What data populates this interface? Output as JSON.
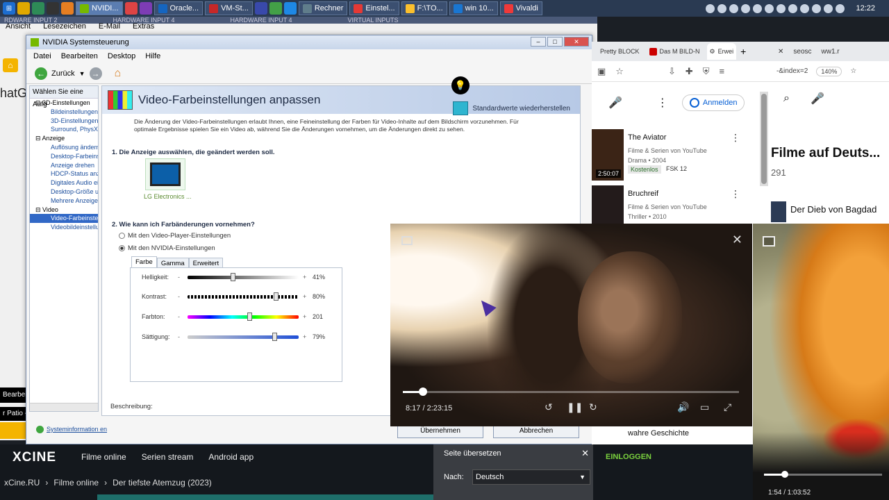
{
  "taskbar": {
    "start_icon": "windows-start-icon",
    "buttons": [
      {
        "label": "NVIDI...",
        "active": true
      },
      {
        "label": "Oracle..."
      },
      {
        "label": "VM-St..."
      },
      {
        "label": "Rechner"
      },
      {
        "label": "Einstel..."
      },
      {
        "label": "F:\\TO..."
      },
      {
        "label": "win 10..."
      },
      {
        "label": "Vivaldi"
      }
    ],
    "clock": "12:22"
  },
  "bg_browser": {
    "overlay_titles": [
      "RDWARE INPUT  2",
      "HARDWARE INPUT 4",
      "HARDWARE INPUT 4",
      "VIRTUAL INPUTS"
    ],
    "menu": [
      "Ansicht",
      "Lesezeichen",
      "E-Mail",
      "Extras"
    ],
    "chat_text": "hatG",
    "bearbeiten": "Bearbei",
    "patio": "r Patio -"
  },
  "nvidia": {
    "window_title": "NVIDIA Systemsteuerung",
    "menu": [
      "Datei",
      "Bearbeiten",
      "Desktop",
      "Hilfe"
    ],
    "back_label": "Zurück",
    "task_header": "Wählen Sie eine Aufg",
    "tree": [
      {
        "type": "g",
        "label": "3D-Einstellungen"
      },
      {
        "type": "i",
        "label": "Bildeinstellungen m"
      },
      {
        "type": "i",
        "label": "3D-Einstellungen"
      },
      {
        "type": "i",
        "label": "Surround, PhysX"
      },
      {
        "type": "g",
        "label": "Anzeige"
      },
      {
        "type": "i",
        "label": "Auflösung ändern"
      },
      {
        "type": "i",
        "label": "Desktop-Farbeins"
      },
      {
        "type": "i",
        "label": "Anzeige drehen"
      },
      {
        "type": "i",
        "label": "HDCP-Status anze"
      },
      {
        "type": "i",
        "label": "Digitales Audio ei"
      },
      {
        "type": "i",
        "label": "Desktop-Größe ur"
      },
      {
        "type": "i",
        "label": "Mehrere Anzeiger"
      },
      {
        "type": "g",
        "label": "Video"
      },
      {
        "type": "i",
        "label": "Video-Farbeinstel",
        "selected": true
      },
      {
        "type": "i",
        "label": "Videobildeinstellu"
      }
    ],
    "sysinfo_label": "Systeminformation en",
    "heading": "Video-Farbeinstellungen anpassen",
    "restore_label": "Standardwerte wiederherstellen",
    "description": "Die Änderung der Video-Farbeinstellungen erlaubt Ihnen, eine Feineinstellung der Farben für Video-Inhalte auf dem Bildschirm vorzunehmen. Für optimale Ergebnisse spielen Sie ein Video ab, während Sie die Änderungen vornehmen, um die Änderungen direkt zu sehen.",
    "step1": "1. Die Anzeige auswählen, die geändert werden soll.",
    "monitor_label": "LG Electronics ...",
    "step2": "2. Wie kann ich Farbänderungen vornehmen?",
    "radio1": "Mit den Video-Player-Einstellungen",
    "radio2": "Mit den NVIDIA-Einstellungen",
    "tabs": [
      "Farbe",
      "Gamma",
      "Erweitert"
    ],
    "sliders": [
      {
        "label": "Helligkeit:",
        "value_text": "41%",
        "level": 0.41
      },
      {
        "label": "Kontrast:",
        "value_text": "80%",
        "level": 0.8
      },
      {
        "label": "Farbton:",
        "value_text": "201",
        "level": 0.56
      },
      {
        "label": "Sättigung:",
        "value_text": "79%",
        "level": 0.79
      }
    ],
    "description_label": "Beschreibung:",
    "apply_button": "Übernehmen",
    "cancel_button": "Abbrechen"
  },
  "right_browser": {
    "tabs": [
      "Pretty BLOCK",
      "Das M BILD-N",
      "Erwei"
    ],
    "signin": "Anmelden",
    "items": [
      {
        "title": "The Aviator",
        "channel": "Filme & Serien von YouTube",
        "meta": "Drama • 2004",
        "duration": "2:50:07",
        "badge": "Kostenlos",
        "fsk": "FSK 12"
      },
      {
        "title": "Bruchreif",
        "channel": "Filme & Serien von YouTube",
        "meta": "Thriller • 2010"
      }
    ],
    "bottom_text": "wahre Geschichte"
  },
  "far_right": {
    "tabs": [
      "seosc",
      "ww1.r"
    ],
    "url": "-&index=2",
    "zoom": "140%",
    "title": "Filme auf Deuts...",
    "count": "291",
    "item": "Der Dieb von Bagdad"
  },
  "pip1": {
    "time": "8:17 / 2:23:15",
    "progress": 0.059
  },
  "pip2": {
    "time": "1:54 / 1:03:52",
    "progress": 0.18
  },
  "xcine": {
    "logo": "XCINE",
    "nav": [
      "Filme online",
      "Serien stream",
      "Android app"
    ],
    "crumbs": [
      "xCine.RU",
      "Filme online",
      "Der tiefste Atemzug (2023)"
    ],
    "login": "EINLOGGEN"
  },
  "translate": {
    "title": "Seite übersetzen",
    "to_label": "Nach:",
    "language": "Deutsch"
  }
}
